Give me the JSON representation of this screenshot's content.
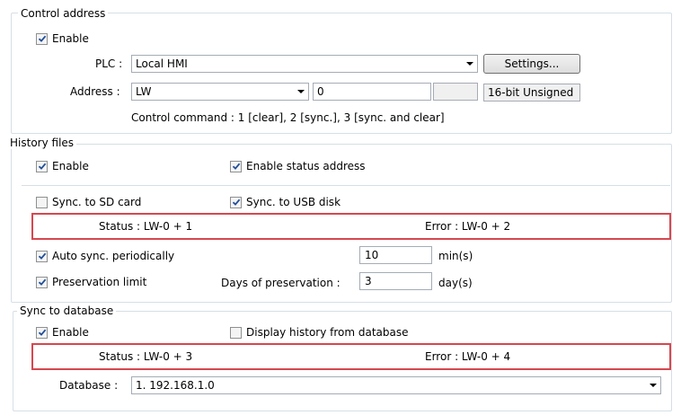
{
  "control_address": {
    "title": "Control address",
    "enable_label": "Enable",
    "plc_label": "PLC :",
    "plc_value": "Local HMI",
    "settings_button": "Settings...",
    "address_label": "Address :",
    "address_type": "LW",
    "address_value": "0",
    "data_format": "16-bit Unsigned",
    "command_note": "Control command : 1 [clear], 2 [sync.], 3 [sync. and clear]"
  },
  "history_files": {
    "title": "History files",
    "enable_label": "Enable",
    "enable_status_label": "Enable status address",
    "sync_sd_label": "Sync. to SD card",
    "sync_usb_label": "Sync. to USB disk",
    "status_text": "Status : LW-0 + 1",
    "error_text": "Error : LW-0 + 2",
    "auto_sync_label": "Auto sync. periodically",
    "auto_sync_value": "10",
    "auto_sync_unit": "min(s)",
    "preservation_label": "Preservation limit",
    "days_label": "Days of preservation :",
    "days_value": "3",
    "days_unit": "day(s)"
  },
  "sync_database": {
    "title": "Sync to database",
    "enable_label": "Enable",
    "display_history_label": "Display history from database",
    "status_text": "Status : LW-0 + 3",
    "error_text": "Error : LW-0 + 4",
    "database_label": "Database :",
    "database_value": "1. 192.168.1.0"
  },
  "checks": {
    "control_enable": true,
    "history_enable": true,
    "enable_status": true,
    "sync_sd": false,
    "sync_usb": true,
    "auto_sync": true,
    "preservation": true,
    "db_enable": true,
    "display_history": false
  },
  "colors": {
    "highlight_border": "#d6474f",
    "group_border": "#d5dfe5"
  }
}
